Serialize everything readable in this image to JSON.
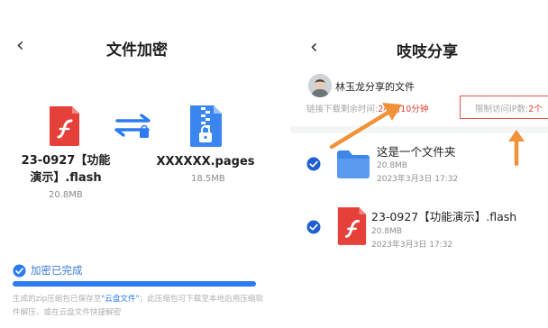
{
  "left_panel": {
    "title": "文件加密",
    "source_file": {
      "name_line1": "23-0927【功能",
      "name_line2": "演示】.flash",
      "size": "20.8MB",
      "icon": "flash-file-icon"
    },
    "convert_icon": "swap-arrows-lock-icon",
    "target_file": {
      "name": "XXXXXX.pages",
      "size": "18.5MB",
      "icon": "zip-file-icon"
    },
    "status": {
      "label": "加密已完成",
      "progress": 1.0
    },
    "note": {
      "part1": "生成的zip压缩包已保存至",
      "highlight": "\"云盘文件\"",
      "part2": "；此压缩包可下载至本地后用压缩软件解压，或在云盘文件快捷解密"
    }
  },
  "right_panel": {
    "title": "吱吱分享",
    "owner": "林玉龙分享的文件",
    "link_label": "链接下载剩余时间:",
    "link_value": "2小时10分钟",
    "limit_label": "限制访问IP数:",
    "limit_value": "2个",
    "files": [
      {
        "name": "这是一个文件夹",
        "size": "20.8MB",
        "date": "2023年3月3日 17:32",
        "icon": "folder-icon"
      },
      {
        "name": "23-0927【功能演示】.flash",
        "size": "20.8MB",
        "date": "2023年3月3日 17:32",
        "icon": "flash-file-icon"
      }
    ]
  },
  "colors": {
    "accent_blue": "#2d7bf0",
    "check_blue": "#1f5fcf",
    "alert_red": "#e23b2e",
    "annotation_orange": "#f0923a",
    "flash_red": "#e5413a"
  }
}
